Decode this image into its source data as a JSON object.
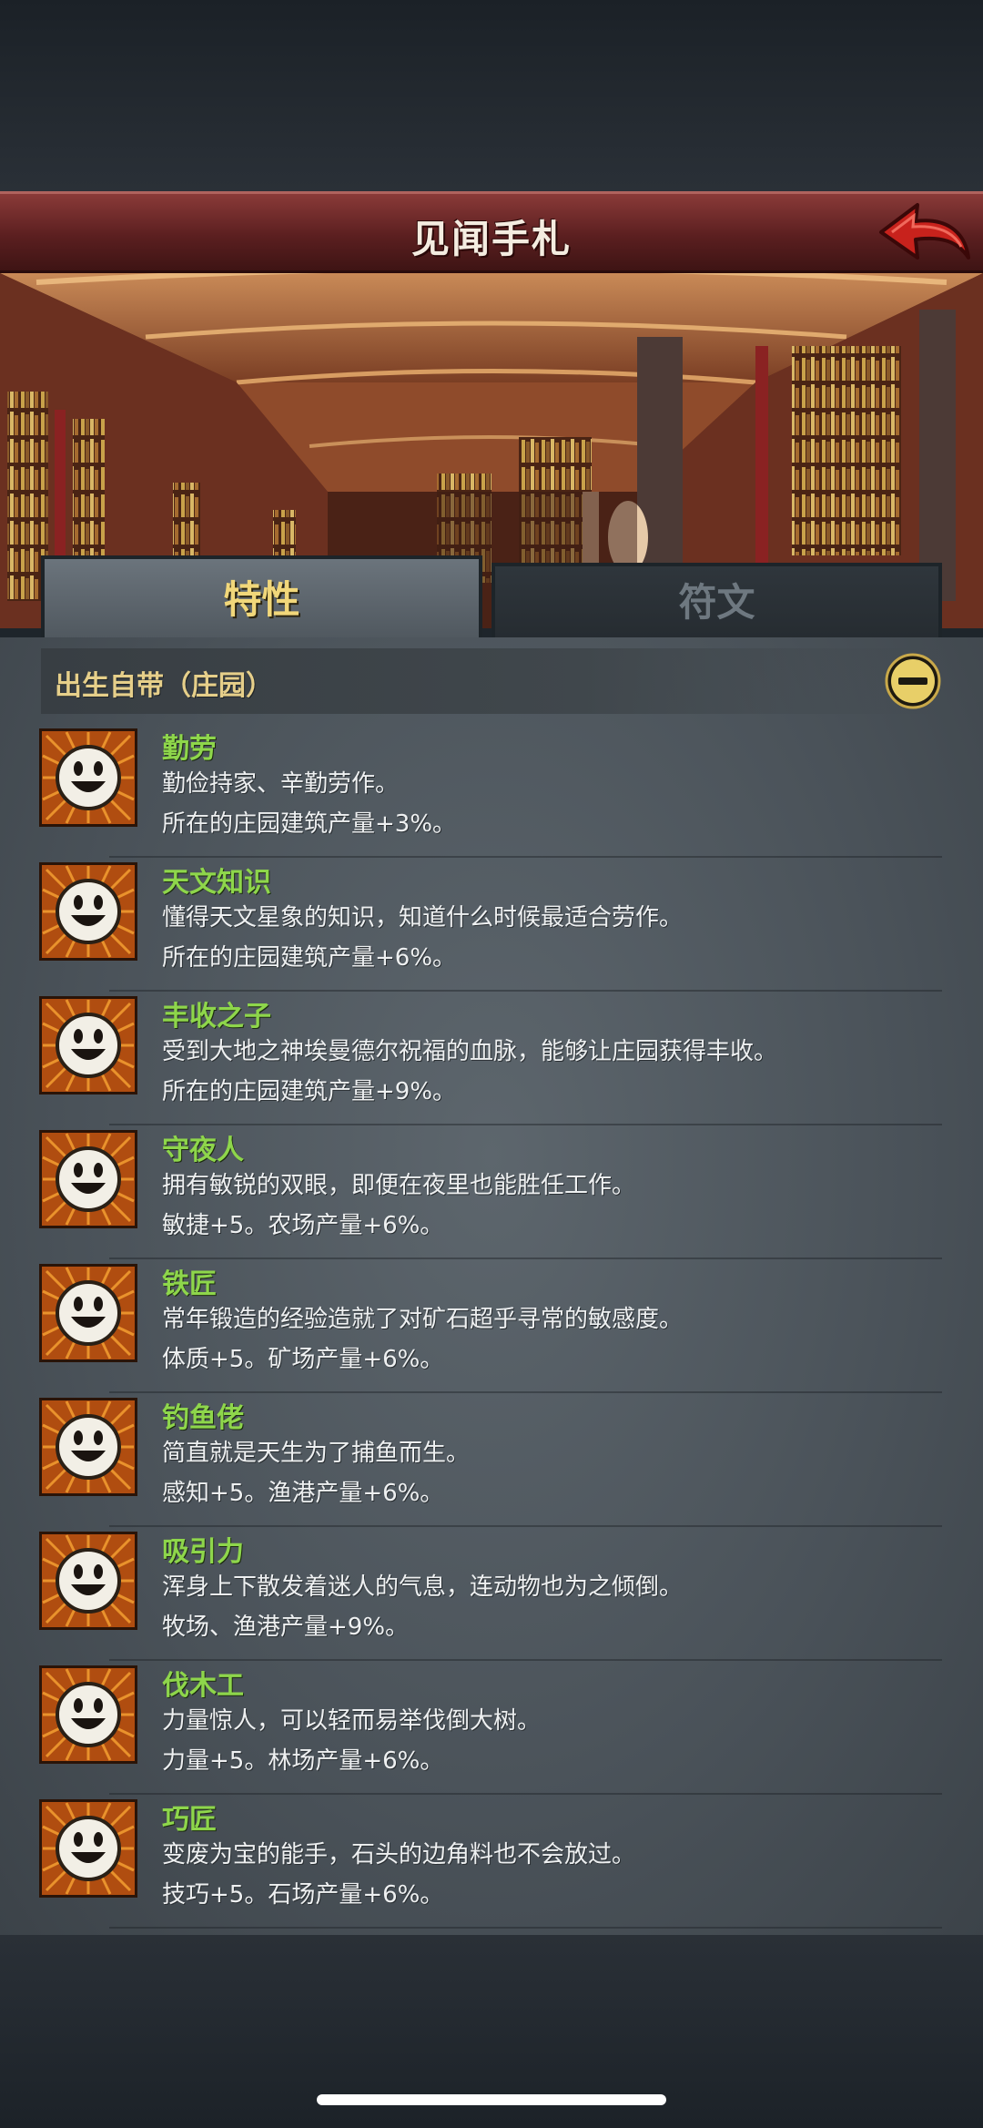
{
  "header": {
    "title": "见闻手札",
    "back_icon": "red-curved-back-arrow-icon"
  },
  "banner": {
    "scene": "library-hall-illustration"
  },
  "tabs": [
    {
      "label": "特性",
      "active": true
    },
    {
      "label": "符文",
      "active": false
    }
  ],
  "section": {
    "title": "出生自带（庄园）",
    "toggle_icon": "minus-circle-icon"
  },
  "traits": [
    {
      "name": "勤劳",
      "desc": "勤俭持家、辛勤劳作。",
      "effect": "所在的庄园建筑产量+3%。",
      "icon": "smiley-face-icon"
    },
    {
      "name": "天文知识",
      "desc": "懂得天文星象的知识，知道什么时候最适合劳作。",
      "effect": "所在的庄园建筑产量+6%。",
      "icon": "smiley-face-icon"
    },
    {
      "name": "丰收之子",
      "desc": "受到大地之神埃曼德尔祝福的血脉，能够让庄园获得丰收。",
      "effect": "所在的庄园建筑产量+9%。",
      "icon": "smiley-face-icon"
    },
    {
      "name": "守夜人",
      "desc": "拥有敏锐的双眼，即便在夜里也能胜任工作。",
      "effect": "敏捷+5。农场产量+6%。",
      "icon": "smiley-face-icon"
    },
    {
      "name": "铁匠",
      "desc": "常年锻造的经验造就了对矿石超乎寻常的敏感度。",
      "effect": "体质+5。矿场产量+6%。",
      "icon": "smiley-face-icon"
    },
    {
      "name": "钓鱼佬",
      "desc": "简直就是天生为了捕鱼而生。",
      "effect": "感知+5。渔港产量+6%。",
      "icon": "smiley-face-icon"
    },
    {
      "name": "吸引力",
      "desc": "浑身上下散发着迷人的气息，连动物也为之倾倒。",
      "effect": "牧场、渔港产量+9%。",
      "icon": "smiley-face-icon"
    },
    {
      "name": "伐木工",
      "desc": "力量惊人，可以轻而易举伐倒大树。",
      "effect": "力量+5。林场产量+6%。",
      "icon": "smiley-face-icon"
    },
    {
      "name": "巧匠",
      "desc": "变废为宝的能手，石头的边角料也不会放过。",
      "effect": "技巧+5。石场产量+6%。",
      "icon": "smiley-face-icon"
    }
  ],
  "colors": {
    "trait_name": "#8ed64b",
    "tab_active": "#f1d77a",
    "title_bar": "#6e2a29"
  }
}
